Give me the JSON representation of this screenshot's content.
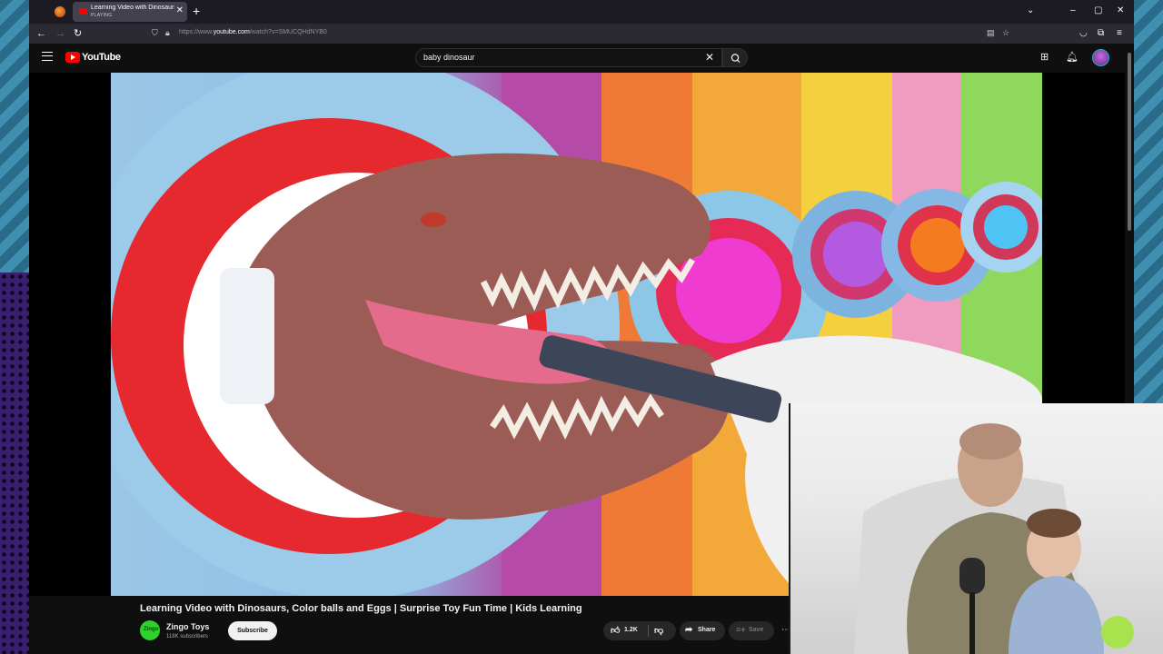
{
  "browser": {
    "tab_title": "Learning Video with Dinosaurs,",
    "tab_status": "PLAYING",
    "url_prefix": "https://www.",
    "url_domain": "youtube.com",
    "url_path": "/watch?v=SMUCQHdNYB0"
  },
  "youtube": {
    "logo_text": "YouTube",
    "search_value": "baby dinosaur"
  },
  "video": {
    "title": "Learning Video with Dinosaurs, Color balls and Eggs | Surprise Toy Fun Time | Kids Learning",
    "channel_name": "Zingo Toys",
    "channel_subscribers": "118K subscribers",
    "channel_avatar_text": "Zingo",
    "subscribe_label": "Subscribe",
    "like_count": "1.2K",
    "share_label": "Share",
    "save_label": "Save"
  },
  "colors": {
    "youtube_red": "#ff0000",
    "page_background": "#0f0f0f",
    "channel_avatar": "#2fd12f"
  },
  "icons": [
    "hamburger-menu-icon",
    "youtube-logo-icon",
    "search-clear-icon",
    "search-icon",
    "create-icon",
    "notifications-icon",
    "like-icon",
    "dislike-icon",
    "share-icon",
    "save-icon",
    "more-icon"
  ]
}
